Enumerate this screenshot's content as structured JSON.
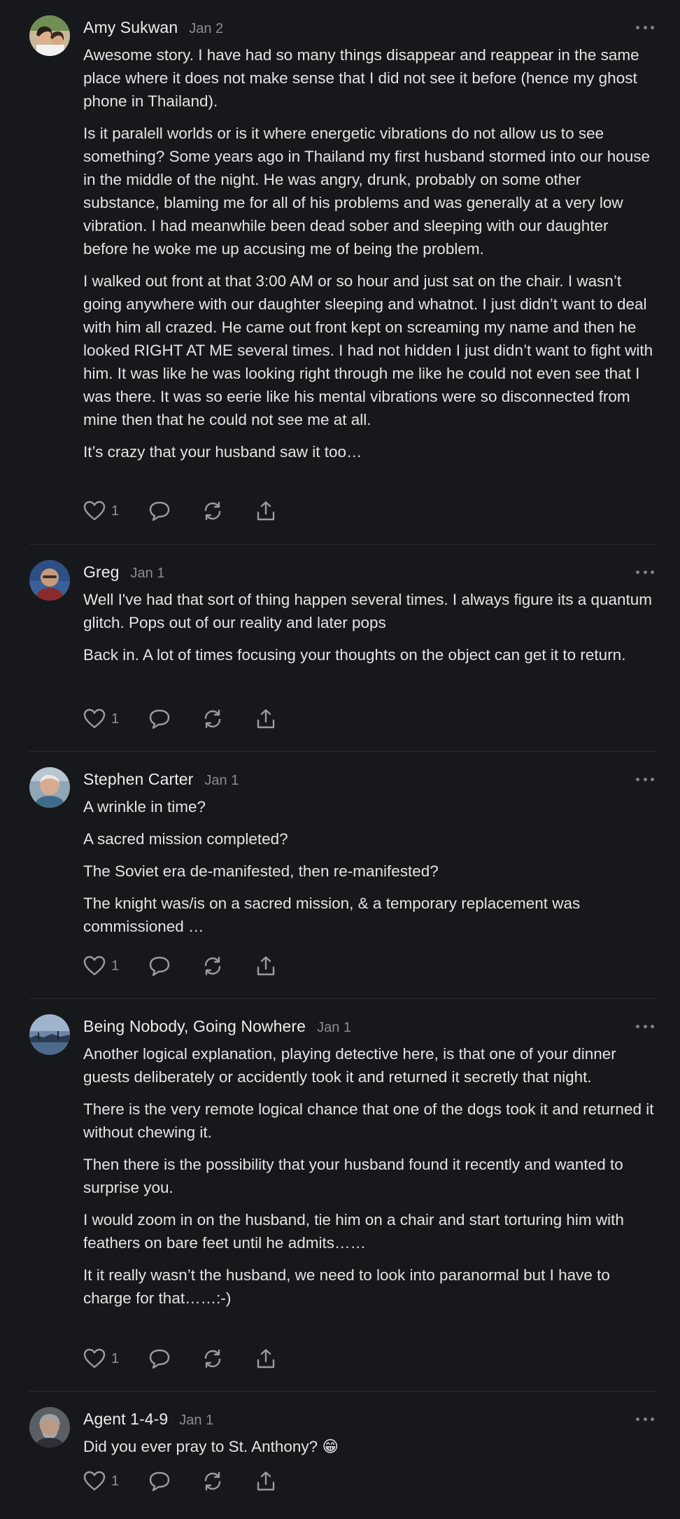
{
  "comments": [
    {
      "author": "Amy Sukwan",
      "date": "Jan 2",
      "avatar": "amy-avatar",
      "paragraphs": [
        "Awesome story. I have had so many things disappear and reappear in the same place where it does not make sense that I did not see it before (hence my ghost phone in Thailand).",
        "Is it paralell worlds or is it where energetic vibrations do not allow us to see something? Some years ago in Thailand my first husband stormed into our house in the middle of the night. He was angry, drunk, probably on some other substance, blaming me for all of his problems and was generally at a very low vibration. I had meanwhile been dead sober and sleeping with our daughter before he woke me up accusing me of being the problem.",
        "I walked out front at that 3:00 AM or so hour and just sat on the chair. I wasn’t going anywhere with our daughter sleeping and whatnot. I just didn’t want to deal with him all crazed. He came out front kept on screaming my name and then he looked RIGHT AT ME several times. I had not hidden I just didn’t want to fight with him. It was like he was looking right through me like he could not even see that I was there. It was so eerie like his mental vibrations were so disconnected from mine then that he could not see me at all.",
        "It’s crazy that your husband saw it too…"
      ],
      "likes": "1"
    },
    {
      "author": "Greg",
      "date": "Jan 1",
      "avatar": "greg-avatar",
      "paragraphs": [
        "Well I've had that sort of thing happen several times. I always figure its a quantum glitch. Pops out of our reality and later pops",
        "Back in. A lot of times focusing your thoughts on the object can get it to return."
      ],
      "likes": "1"
    },
    {
      "author": "Stephen Carter",
      "date": "Jan 1",
      "avatar": "stephen-avatar",
      "paragraphs": [
        "A wrinkle in time?",
        "A sacred mission completed?",
        "The Soviet era de-manifested, then re-manifested?",
        "The knight was/is on a sacred mission, & a temporary replacement was commissioned …"
      ],
      "likes": "1"
    },
    {
      "author": "Being Nobody, Going Nowhere",
      "date": "Jan 1",
      "avatar": "landscape-avatar",
      "paragraphs": [
        "Another logical explanation, playing detective here, is that one of your dinner guests deliberately or accidently took it and returned it secretly that night.",
        "There is the very remote logical chance that one of the dogs took it and returned it without chewing it.",
        "Then there is the possibility that your husband found it recently and wanted to surprise you.",
        "I would zoom in on the husband, tie him on a chair and start torturing him with feathers on bare feet until he admits……",
        "It it really wasn’t the husband, we need to look into paranormal but I have to charge for that……:-)"
      ],
      "likes": "1"
    },
    {
      "author": "Agent 1-4-9",
      "date": "Jan 1",
      "avatar": "agent-avatar",
      "paragraphs": [
        "Did you ever pray to St. Anthony? 😁"
      ],
      "likes": "1"
    }
  ],
  "icons": {
    "like": "heart-icon",
    "reply": "comment-bubble-icon",
    "restack": "restack-icon",
    "share": "share-icon",
    "more": "more-options-icon"
  },
  "colors": {
    "background": "#17181b",
    "text": "#e4e4e4",
    "muted": "#8a8c91",
    "divider": "#2c2e33"
  }
}
